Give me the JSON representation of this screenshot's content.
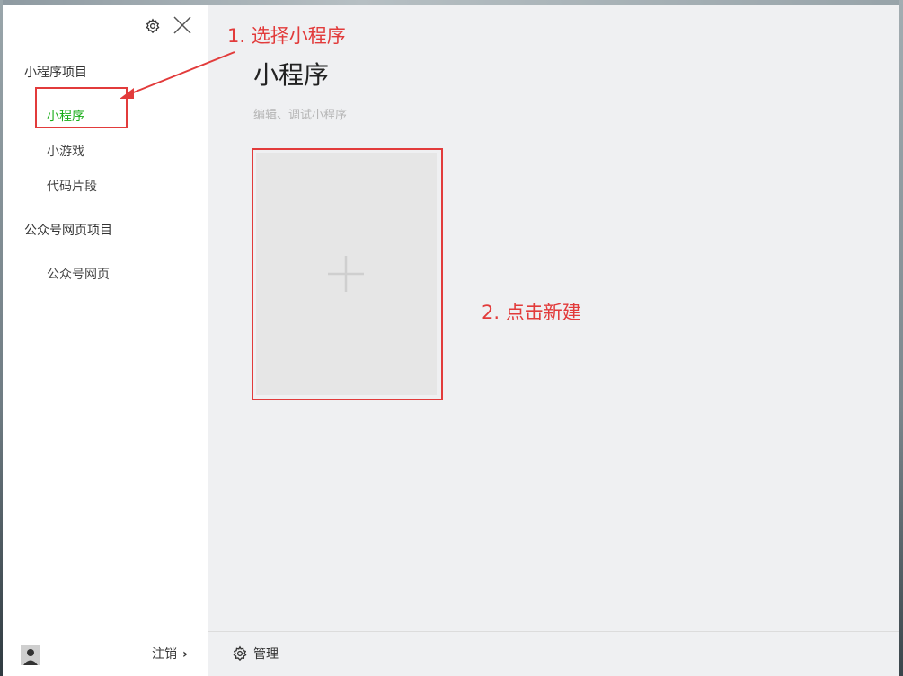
{
  "sidebar": {
    "groups": [
      {
        "label": "小程序项目",
        "items": [
          {
            "label": "小程序"
          },
          {
            "label": "小游戏"
          },
          {
            "label": "代码片段"
          }
        ]
      },
      {
        "label": "公众号网页项目",
        "items": [
          {
            "label": "公众号网页"
          }
        ]
      }
    ],
    "logout_label": "注销",
    "active_item": "小程序"
  },
  "main": {
    "title": "小程序",
    "subtitle": "编辑、调试小程序"
  },
  "bottombar": {
    "manage_label": "管理"
  },
  "annotations": {
    "step1": "1. 选择小程序",
    "step2": "2. 点击新建"
  },
  "colors": {
    "active": "#1aad19",
    "annotation": "#e23b3b",
    "background": "#eff0f2",
    "card": "#e6e6e6"
  }
}
